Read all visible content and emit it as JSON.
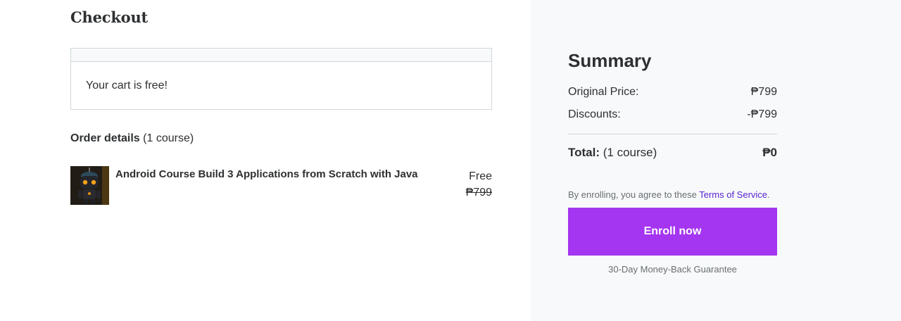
{
  "checkout": {
    "title": "Checkout",
    "cart_message": "Your cart is free!",
    "order_details_label": "Order details",
    "order_details_count": "(1 course)",
    "course": {
      "title": "Android Course Build 3 Applications from Scratch with Java",
      "price_label": "Free",
      "original_price": "₱799",
      "thumbnail_icon": "robot-thumbnail"
    }
  },
  "summary": {
    "title": "Summary",
    "original_price_label": "Original Price:",
    "original_price_value": "₱799",
    "discounts_label": "Discounts:",
    "discounts_value": "-₱799",
    "total_label": "Total:",
    "total_count": "(1 course)",
    "total_value": "₱0",
    "terms_prefix": "By enrolling, you agree to these ",
    "terms_link": "Terms of Service",
    "terms_suffix": ".",
    "enroll_button": "Enroll now",
    "guarantee": "30-Day Money-Back Guarantee"
  },
  "colors": {
    "accent": "#a435f0",
    "link": "#5624d0",
    "summary_bg": "#f7f9fa",
    "text": "#2d2f31"
  }
}
